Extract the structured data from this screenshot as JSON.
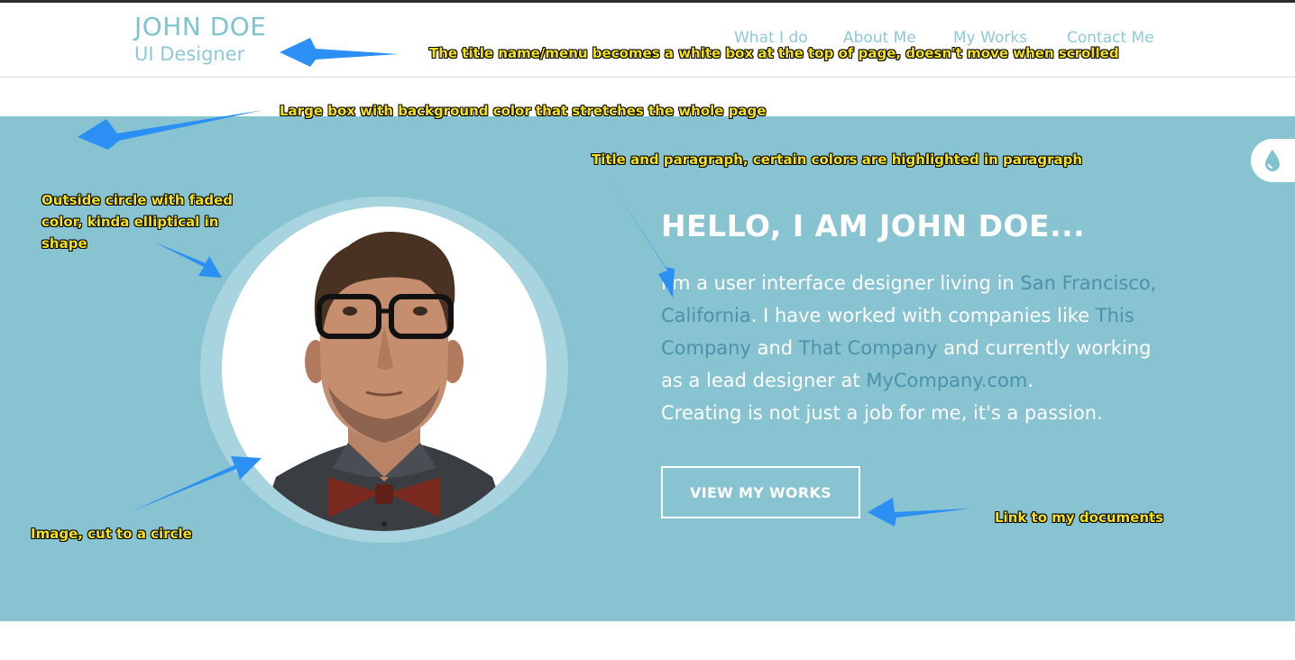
{
  "header": {
    "name": "JOHN DOE",
    "role": "UI Designer",
    "nav": [
      "What I do",
      "About Me",
      "My Works",
      "Contact Me"
    ]
  },
  "hero": {
    "title": "HELLO, I AM JOHN DOE...",
    "paragraph": {
      "p1": "I'm a user interface designer living in ",
      "h1": "San Francisco, California",
      "p2": ". I have worked with companies like ",
      "h2": "This Company",
      "p3": " and ",
      "h3": "That Company",
      "p4": " and currently working as a lead designer at ",
      "h4": "MyCompany.com",
      "p5": ".",
      "p6": "Creating is not just a job for me, it's a passion."
    },
    "cta_label": "VIEW MY WORKS",
    "side_tab_icon": "water-drop-icon"
  },
  "annotations": {
    "header_note": "The title name/menu becomes a white box at the top of page, doesn't move when scrolled",
    "hero_box_note": "Large box with background color that stretches the whole page",
    "title_note": "Title and paragraph, certain colors are highlighted in paragraph",
    "outer_circle_note": "Outside circle with faded color, kinda elliptical in shape",
    "image_note": "Image, cut to a circle",
    "link_note": "Link to my documents"
  },
  "colors": {
    "hero_background": "#87c3d1",
    "accent": "#7fc3d1",
    "highlight_text": "#4a93aa",
    "annotation_text": "#f4e11a",
    "annotation_arrow": "#2b8ff3"
  }
}
